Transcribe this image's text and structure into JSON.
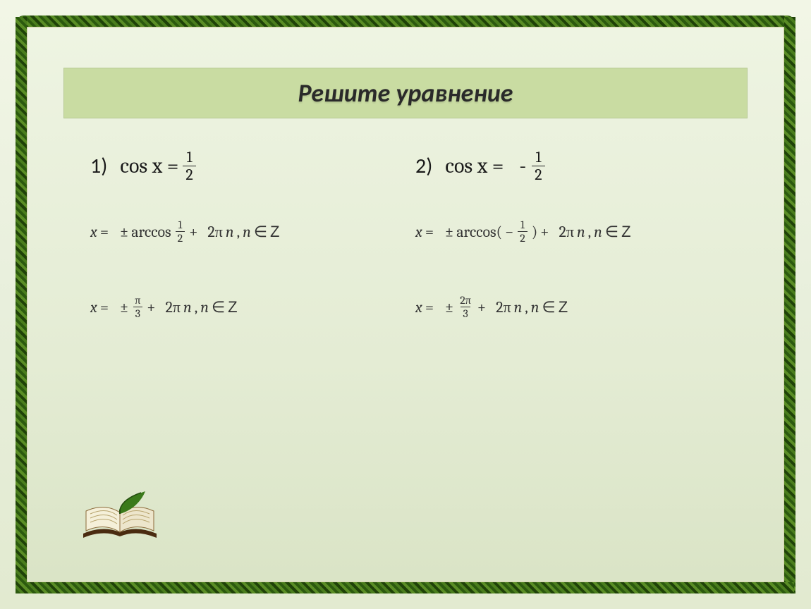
{
  "title": "Решите   уравнение",
  "problems": {
    "p1": {
      "num": "1)",
      "lhs": "cos x =",
      "frac_n": "1",
      "frac_d": "2",
      "step1": {
        "x": "x",
        "eq": "=",
        "pm": "±",
        "fn": "arccos",
        "arg_n": "1",
        "arg_d": "2",
        "plus": "+",
        "coef": "2π",
        "n1": "n",
        "comma": ",",
        "n2": "n",
        "in": "∈",
        "z": "Z"
      },
      "step2": {
        "x": "x",
        "eq": "=",
        "pm": "±",
        "fr_n": "π",
        "fr_d": "3",
        "plus": "+",
        "coef": "2π",
        "n1": "n",
        "comma": ",",
        "n2": "n",
        "in": "∈",
        "z": "Z"
      }
    },
    "p2": {
      "num": "2)",
      "lhs": "cos x =",
      "minus": "-",
      "frac_n": "1",
      "frac_d": "2",
      "step1": {
        "x": "x",
        "eq": "=",
        "pm": "±",
        "fn": "arccos(",
        "neg": "−",
        "arg_n": "1",
        "arg_d": "2",
        "close": ")",
        "plus": "+",
        "coef": "2π",
        "n1": "n",
        "comma": ",",
        "n2": "n",
        "in": "∈",
        "z": "Z"
      },
      "step2": {
        "x": "x",
        "eq": "=",
        "pm": "±",
        "fr_n": "2π",
        "fr_d": "3",
        "plus": "+",
        "coef": "2π",
        "n1": "n",
        "comma": ",",
        "n2": "n",
        "in": "∈",
        "z": "Z"
      }
    }
  }
}
